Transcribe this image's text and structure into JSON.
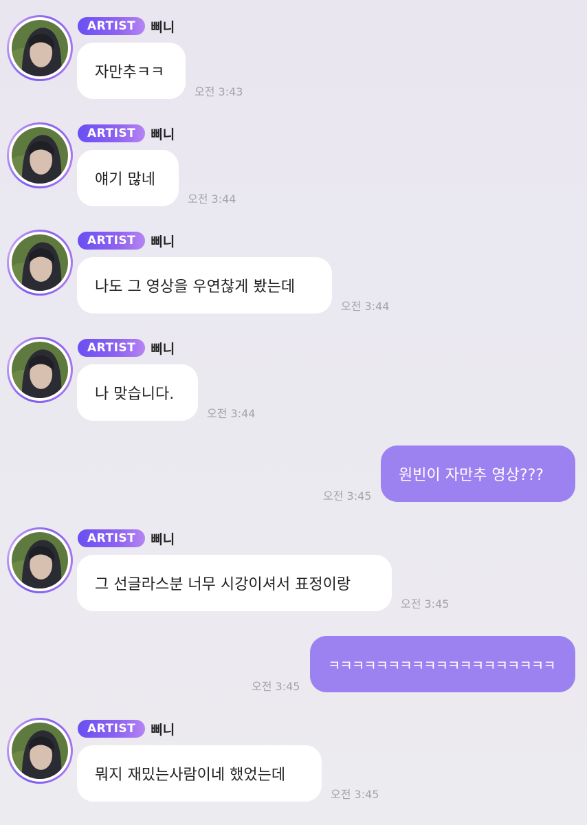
{
  "messages": [
    {
      "badge": "ARTIST",
      "sender": "삐니",
      "text": "자만추ㅋㅋ",
      "time": "오전 3:43"
    },
    {
      "badge": "ARTIST",
      "sender": "삐니",
      "text": "얘기 많네",
      "time": "오전 3:44"
    },
    {
      "badge": "ARTIST",
      "sender": "삐니",
      "text": "나도 그 영상을 우연찮게 봤는데",
      "time": "오전 3:44"
    },
    {
      "badge": "ARTIST",
      "sender": "삐니",
      "text": "나 맞습니다.",
      "time": "오전 3:44"
    },
    {
      "text": "원빈이 자만추 영상???",
      "time": "오전 3:45"
    },
    {
      "badge": "ARTIST",
      "sender": "삐니",
      "text": "그 선글라스분 너무 시강이셔서 표정이랑",
      "time": "오전 3:45"
    },
    {
      "text": "ㅋㅋㅋㅋㅋㅋㅋㅋㅋㅋㅋㅋㅋㅋㅋㅋㅋㅋㅋ",
      "time": "오전 3:45"
    },
    {
      "badge": "ARTIST",
      "sender": "삐니",
      "text": "뭐지 재밌는사람이네 했었는데",
      "time": "오전 3:45"
    }
  ],
  "colors": {
    "background": "#ebe9f0",
    "incoming_bubble": "#ffffff",
    "outgoing_bubble": "#9c82f0",
    "badge_start": "#6a4ff3",
    "badge_end": "#b584f3",
    "timestamp": "#a4a3aa"
  },
  "icons": {
    "avatar": "avatar-photo"
  }
}
